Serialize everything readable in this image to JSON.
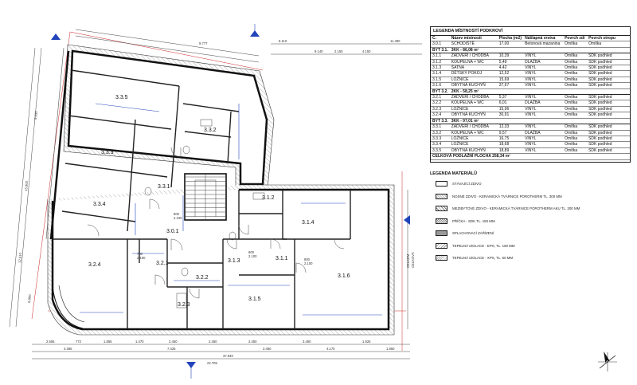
{
  "rooms": {
    "r335": "3.3.5",
    "r332": "3.3.2",
    "r333": "3.3.3",
    "r331": "3.3.1",
    "r334": "3.3.4",
    "r312": "3.1.2",
    "r301": "3.0.1",
    "r314": "3.1.4",
    "r324": "3.2.4",
    "r321": "3.2.1",
    "r313": "3.1.3",
    "r311": "3.1.1",
    "r316": "3.1.6",
    "r322": "3.2.2",
    "r323": "3.2.3",
    "r315": "3.1.5"
  },
  "dimensions": {
    "top": [
      "9.777",
      "6.110",
      "2.150",
      "9.140",
      "4.150",
      "11.490"
    ],
    "bottom_row1": [
      "2.555",
      "772",
      "1.855",
      "1.470",
      "2.450",
      "2.450",
      "2.450",
      "3.450",
      "1.925"
    ],
    "bottom_row2": [
      "3.365",
      "7.425",
      "3.450",
      "4.170",
      "1.850"
    ],
    "bottom_total": "37.640",
    "bottom_overall": "22.705",
    "right": [
      "CELKEM",
      "CELKOVÁ"
    ],
    "left": [
      "15.900",
      "9.030",
      "12.610",
      "8.860"
    ],
    "doors": [
      "700",
      "2.100",
      "800",
      "2.100",
      "600",
      "2.100",
      "800",
      "2.100"
    ]
  },
  "legend": {
    "title": "LEGENDA MÍSTNOSTÍ PODKROVÍ",
    "headers": [
      "Č.",
      "Název místnosti",
      "Plocha (m2)",
      "Nášlapná vrstva",
      "Povrch zdí",
      "Povrch stropu"
    ],
    "rows": [
      {
        "type": "row",
        "cells": [
          "3.0.1",
          "SCHODIŠTĚ",
          "17,00",
          "Betonová mazanina",
          "Omítka",
          "Omítka"
        ]
      },
      {
        "type": "grp",
        "cells": [
          "BYT 3.1.",
          "3KK - 86,08 m²",
          "",
          "",
          "",
          ""
        ]
      },
      {
        "type": "row",
        "cells": [
          "3.1.1",
          "ZÁDVEŘÍ / CHODBA",
          "10,39",
          "VINYL",
          "Omítka",
          "SDK podhled"
        ]
      },
      {
        "type": "row",
        "cells": [
          "3.1.2",
          "KOUPELNA + WC",
          "5,49",
          "DLAŽBA",
          "Omítka",
          "SDK podhled"
        ]
      },
      {
        "type": "row",
        "cells": [
          "3.1.3",
          "ŠATNA",
          "4,42",
          "VINYL",
          "Omítka",
          "SDK podhled"
        ]
      },
      {
        "type": "row",
        "cells": [
          "3.1.4",
          "DĚTSKÝ POKOJ",
          "12,52",
          "VINYL",
          "Omítka",
          "SDK podhled"
        ]
      },
      {
        "type": "row",
        "cells": [
          "3.1.5",
          "LOŽNICE",
          "15,69",
          "VINYL",
          "Omítka",
          "SDK podhled"
        ]
      },
      {
        "type": "row",
        "cells": [
          "3.1.6",
          "OBYTNÁ KUCHYŇ",
          "37,67",
          "VINYL",
          "Omítka",
          "SDK podhled"
        ]
      },
      {
        "type": "grp",
        "cells": [
          "BYT 3.2.",
          "2KK - 58,25 m²",
          "",
          "",
          "",
          ""
        ]
      },
      {
        "type": "row",
        "cells": [
          "3.2.1",
          "ZÁDVEŘÍ / CHODBA",
          "5,37",
          "VINYL",
          "Omítka",
          "SDK podhled"
        ]
      },
      {
        "type": "row",
        "cells": [
          "3.2.2",
          "KOUPELNA + WC",
          "6,01",
          "DLAŽBA",
          "Omítka",
          "SDK podhled"
        ]
      },
      {
        "type": "row",
        "cells": [
          "3.2.3",
          "LOŽNICE",
          "15,96",
          "VINYL",
          "Omítka",
          "SDK podhled"
        ]
      },
      {
        "type": "row",
        "cells": [
          "3.2.4",
          "OBYTNÁ KUCHYŇ",
          "30,91",
          "VINYL",
          "Omítka",
          "SDK podhled"
        ]
      },
      {
        "type": "grp",
        "cells": [
          "BYT 3.3.",
          "3KK - 97,01 m²",
          "",
          "",
          "",
          ""
        ]
      },
      {
        "type": "row",
        "cells": [
          "3.3.1",
          "ZÁDVEŘÍ / CHODBA",
          "12,33",
          "VINYL",
          "Omítka",
          "SDK podhled"
        ]
      },
      {
        "type": "row",
        "cells": [
          "3.3.2",
          "KOUPELNA + WC",
          "9,57",
          "DLAŽBA",
          "Omítka",
          "SDK podhled"
        ]
      },
      {
        "type": "row",
        "cells": [
          "3.3.3",
          "LOŽNICE",
          "16,75",
          "VINYL",
          "Omítka",
          "SDK podhled"
        ]
      },
      {
        "type": "row",
        "cells": [
          "3.3.4",
          "LOŽNICE",
          "18,68",
          "VINYL",
          "Omítka",
          "SDK podhled"
        ]
      },
      {
        "type": "row",
        "cells": [
          "3.3.5",
          "OBYTNÁ KUCHYŇ",
          "18,89",
          "VINYL",
          "Omítka",
          "SDK podhled"
        ]
      },
      {
        "type": "tot",
        "cells": [
          "CELKOVÁ PODLAŽNÍ PLOCHA 258,34 m²",
          "",
          "",
          "",
          "",
          ""
        ]
      }
    ]
  },
  "materials": {
    "title": "LEGENDA MATERIÁLŮ",
    "items": [
      {
        "text": "STÁVAJÍCÍ ZDIVO",
        "style": "plain"
      },
      {
        "text": "NOSNÉ ZDIVO - KERAMICKÁ TVÁRNICE POROTHERM TL. 300 MM",
        "style": "hatch-b"
      },
      {
        "text": "MEZIBYTOVÉ ZDIVO - KERAMICKÁ TVÁRNICE POROTHERM AKU TL. 300 MM",
        "style": "hatch-a"
      },
      {
        "text": "PŘÍČKA - SDK TL. 150 MM",
        "style": "hatch-c"
      },
      {
        "text": "SPLACHOVACÍ ZAŘÍZENÍ",
        "style": "hatch-e"
      },
      {
        "text": "TEPELNÁ IZOLACE - EPS, TL. 160 MM",
        "style": "hatch-f"
      },
      {
        "text": "TEPELNÁ IZOLACE - XPS, TL. 50 MM",
        "style": "hatch-g"
      }
    ]
  },
  "colors": {
    "wall": "#111111",
    "dimension_blue": "#2244bb",
    "axis_red": "#cc2222",
    "hatch": "#555555"
  }
}
